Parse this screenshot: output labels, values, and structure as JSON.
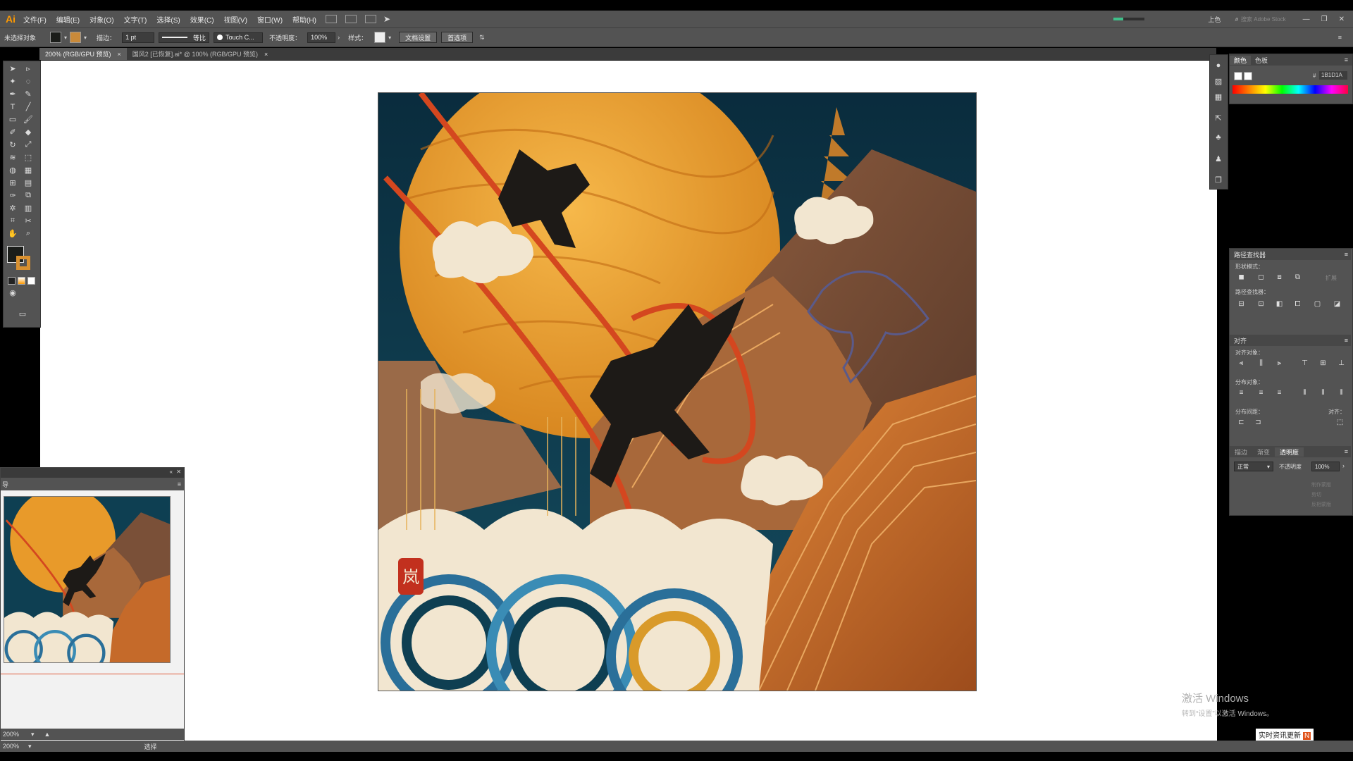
{
  "app": {
    "logo": "Ai",
    "accent": "#ff9a00"
  },
  "menu": [
    "文件(F)",
    "编辑(E)",
    "对象(O)",
    "文字(T)",
    "选择(S)",
    "效果(C)",
    "视图(V)",
    "窗口(W)",
    "帮助(H)"
  ],
  "topright": {
    "workspace": "上色",
    "search_placeholder": "搜索 Adobe Stock"
  },
  "control": {
    "selection": "未选择对象",
    "stroke_label": "描边：",
    "stroke_value": "1 pt",
    "stroke_profile": "等比",
    "brush": "Touch C...",
    "opacity_label": "不透明度：",
    "opacity_value": "100%",
    "style_label": "样式：",
    "doc_setup": "文档设置",
    "preferences": "首选项"
  },
  "tabs": [
    {
      "label": "200% (RGB/GPU 预览)",
      "active": true
    },
    {
      "label": "国风2 [已恢复].ai* @ 100% (RGB/GPU 预览)",
      "active": false
    }
  ],
  "navigator": {
    "tab": "导",
    "zoom": "200%"
  },
  "status": {
    "zoom": "200%",
    "mode": "选择"
  },
  "color_panel": {
    "tab1": "颜色",
    "tab2": "色板",
    "hex": "1B1D1A"
  },
  "pathfinder": {
    "title": "路径查找器",
    "shape_modes": "形状模式：",
    "expand": "扩展",
    "pathfinders": "路径查找器："
  },
  "align": {
    "title": "对齐",
    "align_objects": "对齐对象：",
    "distribute_objects": "分布对象：",
    "distribute_spacing": "分布间距：",
    "align_to": "对齐："
  },
  "transparency": {
    "tabs": [
      "描边",
      "渐变",
      "透明度"
    ],
    "blend": "正常",
    "opacity_label": "不透明度",
    "opacity_value": "100%",
    "make_mask": "制作蒙版",
    "clip": "剪切",
    "invert": "反相蒙版"
  },
  "artwork": {
    "seal_char": "岚",
    "colors": {
      "moon": "#f0a22a",
      "sky": "#0e3f52",
      "mountain": "#c56a2a",
      "wave": "#2a6f99",
      "cloud": "#f2e6d0",
      "deer": "#1d1a17",
      "ribbon": "#d4471f"
    }
  },
  "watermark": {
    "line1": "激活 Windows",
    "line2": "转到“设置”以激活 Windows。"
  },
  "news": {
    "text": "实时资讯更新",
    "badge": "N"
  }
}
